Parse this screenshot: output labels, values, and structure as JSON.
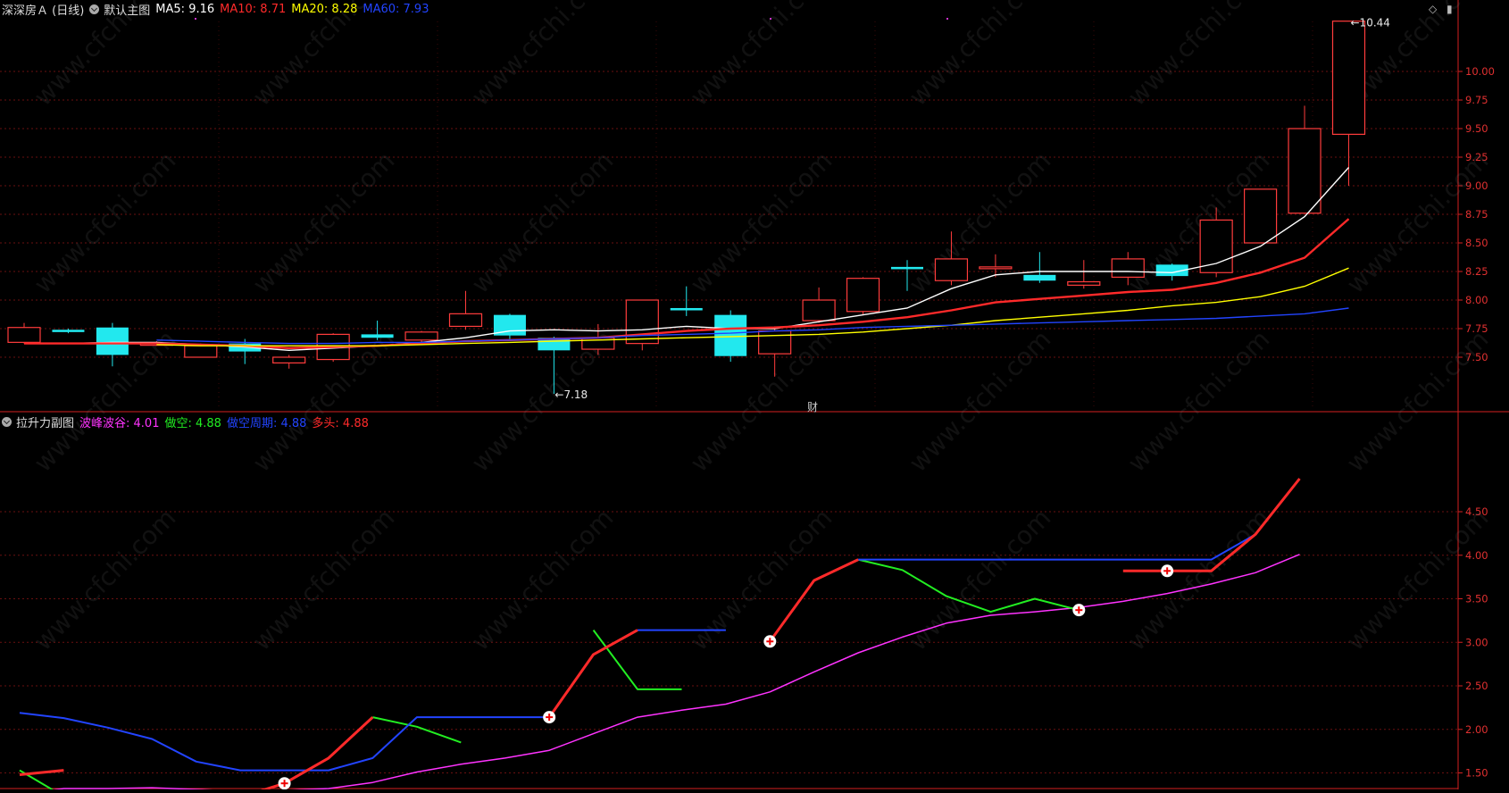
{
  "main_header": {
    "title": "深深房Ａ (日线)",
    "indicator": "默认主图",
    "ma5": {
      "label": "MA5: 9.16",
      "color": "#ffffff"
    },
    "ma10": {
      "label": "MA10: 8.71",
      "color": "#ff2a2a"
    },
    "ma20": {
      "label": "MA20: 8.28",
      "color": "#ffff00"
    },
    "ma60": {
      "label": "MA60: 7.93",
      "color": "#2244ff"
    }
  },
  "sub_header": {
    "title": "拉升力副图",
    "s1": {
      "label": "波峰波谷: 4.01",
      "color": "#ff33ff"
    },
    "s2": {
      "label": "做空: 4.88",
      "color": "#22ee22"
    },
    "s3": {
      "label": "做空周期: 4.88",
      "color": "#2244ff"
    },
    "s4": {
      "label": "多头: 4.88",
      "color": "#ff2a2a"
    }
  },
  "marker_cai": "财",
  "watermark": "www.cfchi.com",
  "window_controls": [
    "◇",
    "▮"
  ],
  "chart_data": [
    {
      "type": "candlestick",
      "name": "main",
      "ylim": [
        7.2,
        10.5
      ],
      "yticks": [
        "10.00",
        "9.75",
        "9.50",
        "9.25",
        "9.00",
        "8.75",
        "8.50",
        "8.25",
        "8.00",
        "7.75",
        "7.50"
      ],
      "annotations": {
        "high": "10.44",
        "low": "7.18"
      },
      "candles": [
        {
          "o": 7.63,
          "c": 7.76,
          "h": 7.8,
          "l": 7.62
        },
        {
          "o": 7.74,
          "c": 7.72,
          "h": 7.75,
          "l": 7.71
        },
        {
          "o": 7.76,
          "c": 7.52,
          "h": 7.8,
          "l": 7.42
        },
        {
          "o": 7.61,
          "c": 7.62,
          "h": 7.64,
          "l": 7.6
        },
        {
          "o": 7.5,
          "c": 7.6,
          "h": 7.62,
          "l": 7.5
        },
        {
          "o": 7.62,
          "c": 7.55,
          "h": 7.66,
          "l": 7.44
        },
        {
          "o": 7.45,
          "c": 7.5,
          "h": 7.52,
          "l": 7.4
        },
        {
          "o": 7.48,
          "c": 7.7,
          "h": 7.71,
          "l": 7.46
        },
        {
          "o": 7.7,
          "c": 7.67,
          "h": 7.82,
          "l": 7.65
        },
        {
          "o": 7.65,
          "c": 7.72,
          "h": 7.73,
          "l": 7.62
        },
        {
          "o": 7.77,
          "c": 7.88,
          "h": 8.08,
          "l": 7.74
        },
        {
          "o": 7.87,
          "c": 7.69,
          "h": 7.88,
          "l": 7.66
        },
        {
          "o": 7.67,
          "c": 7.56,
          "h": 7.68,
          "l": 7.18
        },
        {
          "o": 7.57,
          "c": 7.67,
          "h": 7.79,
          "l": 7.52
        },
        {
          "o": 7.62,
          "c": 8.0,
          "h": 8.0,
          "l": 7.56
        },
        {
          "o": 7.93,
          "c": 7.91,
          "h": 8.12,
          "l": 7.86
        },
        {
          "o": 7.87,
          "c": 7.51,
          "h": 7.91,
          "l": 7.46
        },
        {
          "o": 7.53,
          "c": 7.73,
          "h": 7.77,
          "l": 7.33
        },
        {
          "o": 7.82,
          "c": 8.0,
          "h": 8.11,
          "l": 7.8
        },
        {
          "o": 7.9,
          "c": 8.19,
          "h": 8.2,
          "l": 7.87
        },
        {
          "o": 8.29,
          "c": 8.27,
          "h": 8.35,
          "l": 8.08
        },
        {
          "o": 8.17,
          "c": 8.36,
          "h": 8.6,
          "l": 8.13
        },
        {
          "o": 8.29,
          "c": 8.29,
          "h": 8.4,
          "l": 8.2
        },
        {
          "o": 8.22,
          "c": 8.17,
          "h": 8.42,
          "l": 8.15
        },
        {
          "o": 8.13,
          "c": 8.16,
          "h": 8.35,
          "l": 8.1
        },
        {
          "o": 8.2,
          "c": 8.36,
          "h": 8.42,
          "l": 8.13
        },
        {
          "o": 8.31,
          "c": 8.21,
          "h": 8.32,
          "l": 8.17
        },
        {
          "o": 8.24,
          "c": 8.7,
          "h": 8.81,
          "l": 8.2
        },
        {
          "o": 8.5,
          "c": 8.97,
          "h": 8.97,
          "l": 8.5
        },
        {
          "o": 8.76,
          "c": 9.5,
          "h": 9.7,
          "l": 8.76
        },
        {
          "o": 9.45,
          "c": 10.44,
          "h": 10.44,
          "l": 9.0
        }
      ],
      "series": [
        {
          "name": "MA5",
          "color": "#ffffff",
          "values": [
            7.62,
            7.62,
            7.63,
            7.63,
            7.61,
            7.59,
            7.56,
            7.58,
            7.6,
            7.63,
            7.67,
            7.73,
            7.74,
            7.73,
            7.74,
            7.77,
            7.75,
            7.75,
            7.81,
            7.87,
            7.93,
            8.1,
            8.22,
            8.25,
            8.25,
            8.25,
            8.24,
            8.32,
            8.47,
            8.73,
            9.16
          ]
        },
        {
          "name": "MA10",
          "color": "#ff2a2a",
          "values": [
            7.62,
            7.62,
            7.62,
            7.62,
            7.61,
            7.6,
            7.58,
            7.59,
            7.6,
            7.62,
            7.64,
            7.65,
            7.66,
            7.67,
            7.7,
            7.73,
            7.75,
            7.76,
            7.78,
            7.81,
            7.85,
            7.91,
            7.98,
            8.01,
            8.04,
            8.07,
            8.09,
            8.15,
            8.24,
            8.37,
            8.71
          ]
        },
        {
          "name": "MA20",
          "color": "#ffff00",
          "values": [
            null,
            null,
            null,
            7.61,
            7.6,
            7.6,
            7.6,
            7.6,
            7.6,
            7.61,
            7.62,
            7.63,
            7.64,
            7.65,
            7.66,
            7.67,
            7.68,
            7.69,
            7.7,
            7.72,
            7.75,
            7.78,
            7.82,
            7.85,
            7.88,
            7.91,
            7.95,
            7.98,
            8.03,
            8.12,
            8.28
          ]
        },
        {
          "name": "MA60",
          "color": "#2244ff",
          "values": [
            null,
            null,
            null,
            7.65,
            7.64,
            7.63,
            7.62,
            7.62,
            7.63,
            7.63,
            7.64,
            7.65,
            7.66,
            7.67,
            7.69,
            7.7,
            7.71,
            7.73,
            7.74,
            7.76,
            7.77,
            7.78,
            7.79,
            7.8,
            7.81,
            7.82,
            7.83,
            7.84,
            7.86,
            7.88,
            7.93
          ]
        }
      ]
    },
    {
      "type": "line",
      "name": "sub",
      "ylim": [
        0.9,
        5.2
      ],
      "yticks": [
        "4.50",
        "4.00",
        "3.50",
        "3.00",
        "2.50",
        "2.00",
        "1.50",
        "1.00"
      ],
      "series": [
        {
          "name": "波峰波谷",
          "color": "#ff33ff",
          "values": [
            1.25,
            1.32,
            1.32,
            1.33,
            1.31,
            1.29,
            1.3,
            1.32,
            1.39,
            1.51,
            1.6,
            1.67,
            1.76,
            1.95,
            2.14,
            2.22,
            2.29,
            2.43,
            2.66,
            2.88,
            3.06,
            3.22,
            3.31,
            3.35,
            3.4,
            3.47,
            3.56,
            3.67,
            3.8,
            4.01
          ]
        },
        {
          "name": "做空",
          "color": "#22ee22",
          "values": [
            1.53,
            1.23,
            1.23,
            1.09,
            0.96,
            null,
            null,
            null,
            2.14,
            2.03,
            1.85,
            null,
            null,
            3.14,
            2.46,
            2.46,
            null,
            null,
            null,
            3.95,
            3.83,
            3.53,
            3.35,
            3.5,
            3.37,
            null,
            null,
            null,
            null,
            null
          ]
        },
        {
          "name": "做空周期",
          "color": "#2244ff",
          "values": [
            2.19,
            2.13,
            2.02,
            1.89,
            1.63,
            1.53,
            1.53,
            1.53,
            1.67,
            2.14,
            2.14,
            2.14,
            2.14,
            null,
            3.14,
            3.14,
            3.14,
            null,
            null,
            3.95,
            3.95,
            3.95,
            3.95,
            3.95,
            3.95,
            3.95,
            3.95,
            3.95,
            4.24,
            null
          ]
        },
        {
          "name": "多头",
          "color": "#ff2a2a",
          "values": [
            1.48,
            1.53,
            null,
            null,
            null,
            1.22,
            1.38,
            1.67,
            2.14,
            null,
            null,
            null,
            2.14,
            2.86,
            3.14,
            null,
            null,
            3.01,
            3.71,
            3.95,
            null,
            null,
            null,
            null,
            null,
            3.82,
            3.82,
            3.82,
            4.24,
            4.88
          ]
        }
      ],
      "signals": [
        6,
        12,
        17,
        24,
        26
      ]
    }
  ]
}
